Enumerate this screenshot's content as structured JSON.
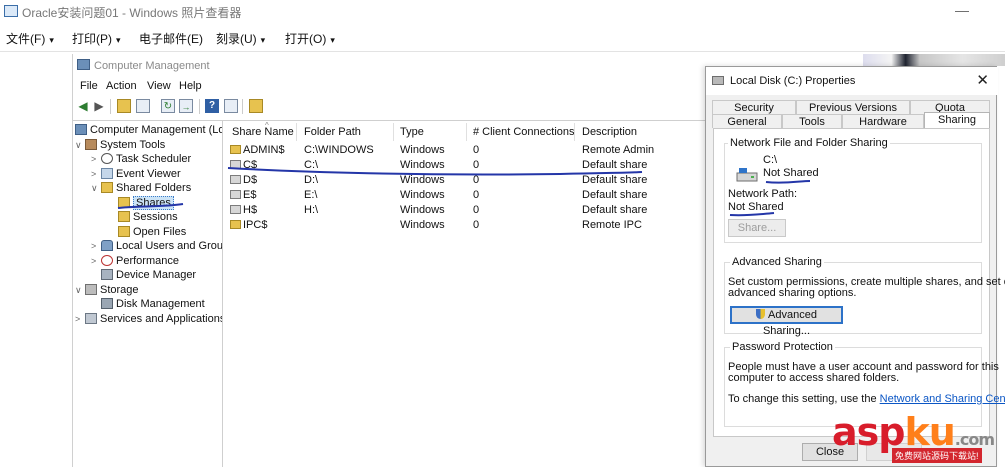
{
  "viewer": {
    "title": "Oracle安装问题01 - Windows 照片查看器",
    "menu": [
      "文件(F)",
      "打印(P)",
      "电子邮件(E)",
      "刻录(U)",
      "打开(O)"
    ],
    "minimize": "—"
  },
  "cm": {
    "title": "Computer Management",
    "menu": [
      "File",
      "Action",
      "View",
      "Help"
    ],
    "toolbar_icons": [
      "back-arrow-icon",
      "forward-arrow-icon",
      "up-folder-icon",
      "show-hide-tree-icon",
      "refresh-icon",
      "export-list-icon",
      "help-icon",
      "view-icon",
      "shared-folder-icon"
    ],
    "tree": [
      {
        "label": "Computer Management (Local",
        "chev": "",
        "icon": "computer-icon"
      },
      {
        "label": "System Tools",
        "chev": "∨",
        "icon": "tools-icon"
      },
      {
        "label": "Task Scheduler",
        "chev": ">",
        "icon": "clock-icon"
      },
      {
        "label": "Event Viewer",
        "chev": ">",
        "icon": "event-viewer-icon"
      },
      {
        "label": "Shared Folders",
        "chev": "∨",
        "icon": "folder-icon"
      },
      {
        "label": "Shares",
        "chev": "",
        "icon": "share-icon"
      },
      {
        "label": "Sessions",
        "chev": "",
        "icon": "sessions-icon"
      },
      {
        "label": "Open Files",
        "chev": "",
        "icon": "open-files-icon"
      },
      {
        "label": "Local Users and Groups",
        "chev": ">",
        "icon": "users-icon"
      },
      {
        "label": "Performance",
        "chev": ">",
        "icon": "performance-icon"
      },
      {
        "label": "Device Manager",
        "chev": "",
        "icon": "device-manager-icon"
      },
      {
        "label": "Storage",
        "chev": "∨",
        "icon": "storage-icon"
      },
      {
        "label": "Disk Management",
        "chev": "",
        "icon": "disk-icon"
      },
      {
        "label": "Services and Applications",
        "chev": ">",
        "icon": "services-icon"
      }
    ],
    "columns": [
      "Share Name",
      "Folder Path",
      "Type",
      "# Client Connections",
      "Description"
    ],
    "rows": [
      {
        "name": "ADMIN$",
        "path": "C:\\WINDOWS",
        "type": "Windows",
        "clients": "0",
        "desc": "Remote Admin"
      },
      {
        "name": "C$",
        "path": "C:\\",
        "type": "Windows",
        "clients": "0",
        "desc": "Default share"
      },
      {
        "name": "D$",
        "path": "D:\\",
        "type": "Windows",
        "clients": "0",
        "desc": "Default share"
      },
      {
        "name": "E$",
        "path": "E:\\",
        "type": "Windows",
        "clients": "0",
        "desc": "Default share"
      },
      {
        "name": "H$",
        "path": "H:\\",
        "type": "Windows",
        "clients": "0",
        "desc": "Default share"
      },
      {
        "name": "IPC$",
        "path": "",
        "type": "Windows",
        "clients": "0",
        "desc": "Remote IPC"
      }
    ]
  },
  "dialog": {
    "title": "Local Disk (C:) Properties",
    "close": "✕",
    "tabs_top": [
      "Security",
      "Previous Versions",
      "Quota"
    ],
    "tabs_bottom": [
      "General",
      "Tools",
      "Hardware",
      "Sharing"
    ],
    "nfs": {
      "label": "Network File and Folder Sharing",
      "drive": "C:\\",
      "status": "Not Shared",
      "path_label": "Network Path:",
      "path_value": "Not Shared",
      "share_btn": "Share..."
    },
    "adv": {
      "label": "Advanced Sharing",
      "desc1": "Set custom permissions, create multiple shares, and set other",
      "desc2": "advanced sharing options.",
      "btn": "Advanced Sharing..."
    },
    "pwd": {
      "label": "Password Protection",
      "desc1": "People must have a user account and password for this",
      "desc2": "computer to access shared folders.",
      "change_prefix": "To change this setting, use the ",
      "link": "Network and Sharing Center",
      "change_suffix": "."
    },
    "close_btn": "Close"
  },
  "watermark": {
    "logo_a": "asp",
    "logo_b": "ku",
    "logo_c": ".com",
    "caption": "免费网站源码下载站!"
  },
  "colors": {
    "accent": "#0b56c5",
    "ink": "#2436a8",
    "watermark_red": "#d81d2b"
  }
}
